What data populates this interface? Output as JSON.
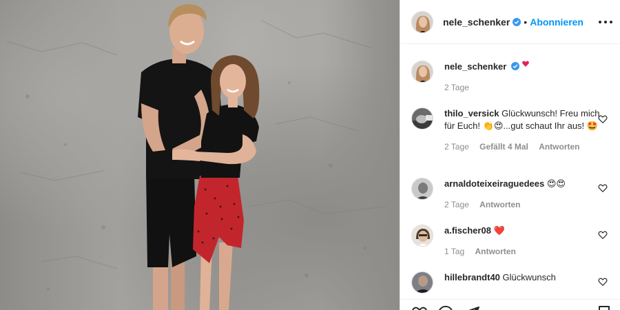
{
  "post_author": {
    "username": "nele_schenker",
    "verified": true,
    "follow_label": "Abonnieren",
    "separator": "•"
  },
  "caption": {
    "username": "nele_schenker",
    "time": "2 Tage"
  },
  "comments": [
    {
      "username": "thilo_versick",
      "text": "Glückwunsch! Freu mich für Euch! 👏😍...gut schaut Ihr aus! 🤩",
      "time": "2 Tage",
      "likes": "Gefällt 4 Mal",
      "reply": "Antworten"
    },
    {
      "username": "arnaldoteixeiraguedees",
      "text": "😍😍",
      "time": "2 Tage",
      "reply": "Antworten"
    },
    {
      "username": "a.fischer08",
      "text": "❤️",
      "time": "1 Tag",
      "reply": "Antworten"
    },
    {
      "username": "hillebrandt40",
      "text": "Glückwunsch"
    }
  ],
  "icons": {
    "verified": "verified-badge-icon",
    "more": "more-options-icon",
    "like": "heart-icon",
    "comment": "comment-icon",
    "share": "paper-plane-icon",
    "save": "bookmark-icon"
  },
  "colors": {
    "accent": "#0095f6",
    "text": "#262626",
    "muted": "#8e8e8e",
    "verified": "#3897f0"
  }
}
